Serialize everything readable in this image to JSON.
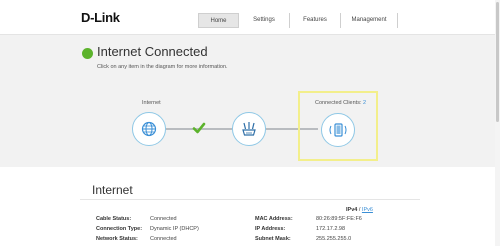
{
  "header": {
    "logo": "D-Link",
    "tabs": [
      {
        "label": "Home",
        "active": true
      },
      {
        "label": "Settings",
        "active": false
      },
      {
        "label": "Features",
        "active": false
      },
      {
        "label": "Management",
        "active": false
      }
    ]
  },
  "status": {
    "title": "Internet Connected",
    "subtitle": "Click on any item in the diagram for more information.",
    "color": "#5cb32c"
  },
  "diagram": {
    "internet_label": "Internet",
    "clients_label": "Connected Clients:",
    "clients_count": "2",
    "nodes": [
      {
        "icon": "globe-icon"
      },
      {
        "icon": "router-icon"
      },
      {
        "icon": "tablet-icon"
      }
    ],
    "highlight_color": "#f3ef8b",
    "accent_color": "#3a8fd6"
  },
  "internet": {
    "title": "Internet",
    "ipv4": "IPv4",
    "sep": "/",
    "ipv6": "IPv6",
    "left_rows": [
      {
        "label": "Cable Status:",
        "value": "Connected"
      },
      {
        "label": "Connection Type:",
        "value": "Dynamic IP (DHCP)"
      },
      {
        "label": "Network Status:",
        "value": "Connected"
      }
    ],
    "right_rows": [
      {
        "label": "MAC Address:",
        "value": "80:26:89:5F:FE:F6"
      },
      {
        "label": "IP Address:",
        "value": "172.17.2.98"
      },
      {
        "label": "Subnet Mask:",
        "value": "255.255.255.0"
      }
    ]
  }
}
